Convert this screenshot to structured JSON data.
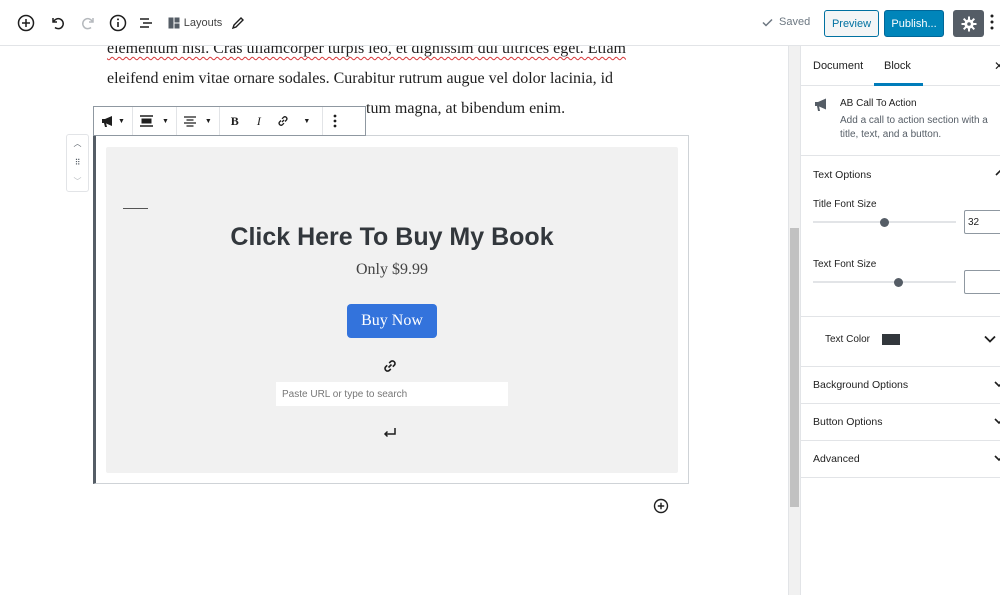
{
  "toolbar": {
    "layouts_label": "Layouts",
    "saved_label": "Saved",
    "preview_label": "Preview",
    "publish_label": "Publish..."
  },
  "editor": {
    "paragraph_lines": [
      "elementum nisi. Cras ullamcorper turpis leo, et dignissim dui ultrices eget. Etiam",
      "eleifend enim vitae ornare sodales. Curabitur rutrum augue vel dolor lacinia, id",
      "tum magna, at bibendum enim."
    ]
  },
  "cta_block": {
    "title": "Click Here To Buy My Book",
    "text": "Only $9.99",
    "button_label": "Buy Now",
    "url_placeholder": "Paste URL or type to search",
    "button_color": "#3373dc",
    "background_color": "#f1f1f1"
  },
  "sidebar": {
    "tabs": [
      {
        "label": "Document",
        "active": false
      },
      {
        "label": "Block",
        "active": true
      }
    ],
    "block_name": "AB Call To Action",
    "block_description": "Add a call to action section with a title, text, and a button.",
    "text_options": {
      "heading": "Text Options",
      "title_font_size_label": "Title Font Size",
      "title_font_size_value": "32",
      "title_font_size_level": 0.5,
      "text_font_size_label": "Text Font Size",
      "text_font_size_value": "",
      "text_font_size_level": 0.6,
      "text_color_label": "Text Color",
      "text_color": "#32373c"
    },
    "panels": [
      "Background Options",
      "Button Options",
      "Advanced"
    ]
  },
  "colors": {
    "accent": "#007cba",
    "publish": "#0085ba"
  }
}
